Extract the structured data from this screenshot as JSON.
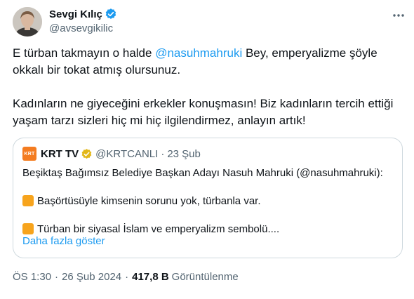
{
  "author": {
    "display_name": "Sevgi Kılıç",
    "handle": "@avsevgikilic",
    "verified_color": "#1d9bf0"
  },
  "tweet": {
    "line1_prefix": "E türban takmayın o halde ",
    "line1_mention": "@nasuhmahruki",
    "line1_suffix": " Bey, emperyalizme şöyle okkalı bir tokat atmış olursunuz.",
    "paragraph2": "Kadınların ne giyeceğini erkekler konuşmasın! Biz kadınların tercih ettiği yaşam tarzı sizleri hiç mi hiç ilgilendirmez, anlayın artık!"
  },
  "quote": {
    "logo_text": "KRT",
    "display_name": "KRT TV",
    "handle": "@KRTCANLI",
    "dot": "·",
    "date": "23 Şub",
    "verified_color": "#e2b719",
    "line1": "Beşiktaş Bağımsız Belediye Başkan Adayı Nasuh Mahruki (@nasuhmahruki):",
    "bullet1": "Başörtüsüyle kimsenin sorunu yok, türbanla var.",
    "bullet2": "Türban bir siyasal İslam ve emperyalizm sembolü....",
    "show_more": "Daha fazla göster",
    "bullet_icon": "orange-square-icon"
  },
  "meta": {
    "time": "ÖS 1:30",
    "dot1": "·",
    "date": "26 Şub 2024",
    "dot2": "·",
    "views_count": "417,8 B",
    "views_label": "Görüntülenme"
  },
  "colors": {
    "accent": "#1d9bf0",
    "text": "#0f1419",
    "secondary": "#536471",
    "border": "#cfd9de",
    "krt_orange": "#f47c20"
  }
}
